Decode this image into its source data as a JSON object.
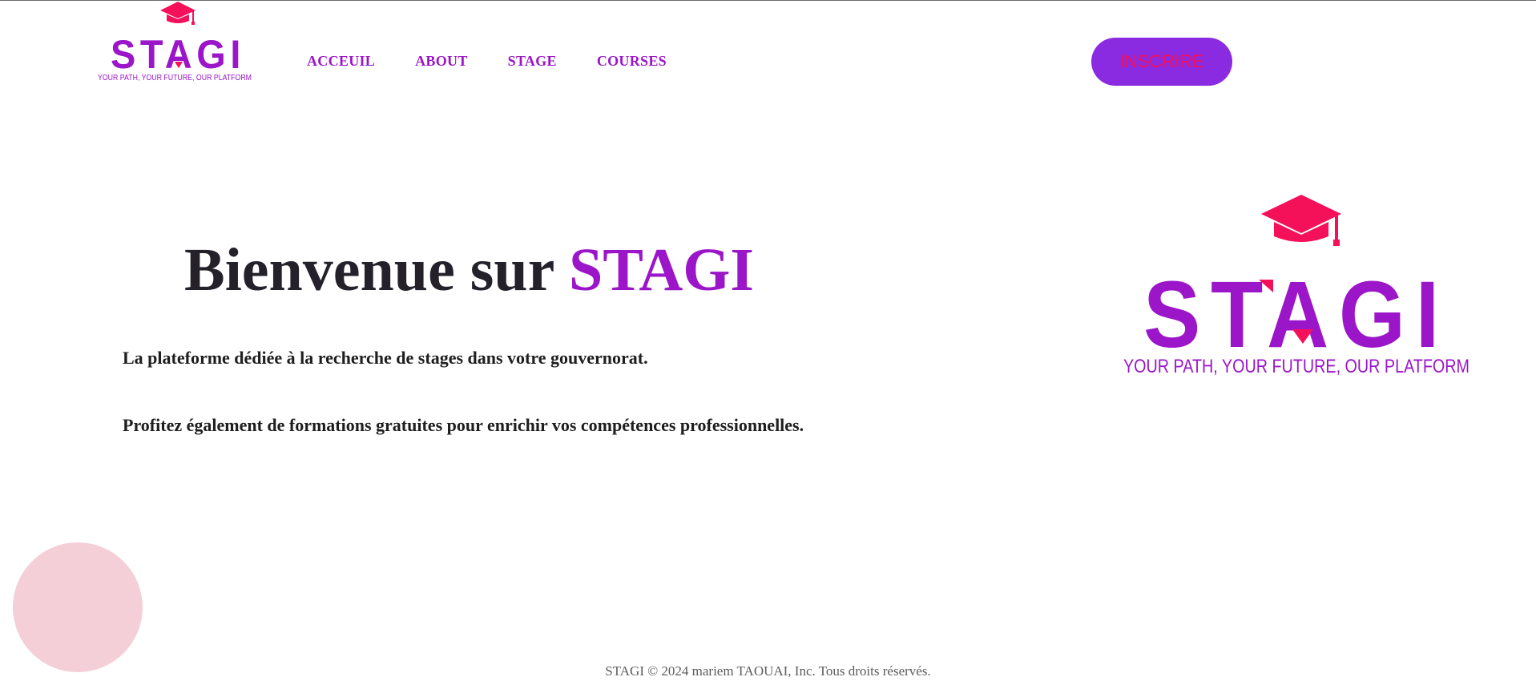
{
  "brand": {
    "name": "STAGI",
    "tagline": "YOUR PATH, YOUR FUTURE, OUR PLATFORM",
    "primary_color": "#9b15c9",
    "accent_color": "#f5105a",
    "logo_icon": "graduation-cap-icon"
  },
  "nav": {
    "items": [
      {
        "label": "ACCEUIL"
      },
      {
        "label": "ABOUT"
      },
      {
        "label": "STAGE"
      },
      {
        "label": "COURSES"
      }
    ],
    "link_color": "#9b15c9"
  },
  "header": {
    "cta_label": "INSCRIRE",
    "cta_background": "#8a2be2",
    "cta_text_color": "#f5105a"
  },
  "hero": {
    "title_prefix": "Bienvenue sur ",
    "title_brand": "STAGI",
    "line1": "La plateforme dédiée à la recherche de stages dans votre gouvernorat.",
    "line2": "Profitez également de formations gratuites pour enrichir vos compétences professionnelles."
  },
  "decoration": {
    "circle_color": "#f4cfd8"
  },
  "footer": {
    "text": "STAGI © 2024 mariem TAOUAI, Inc. Tous droits réservés."
  }
}
